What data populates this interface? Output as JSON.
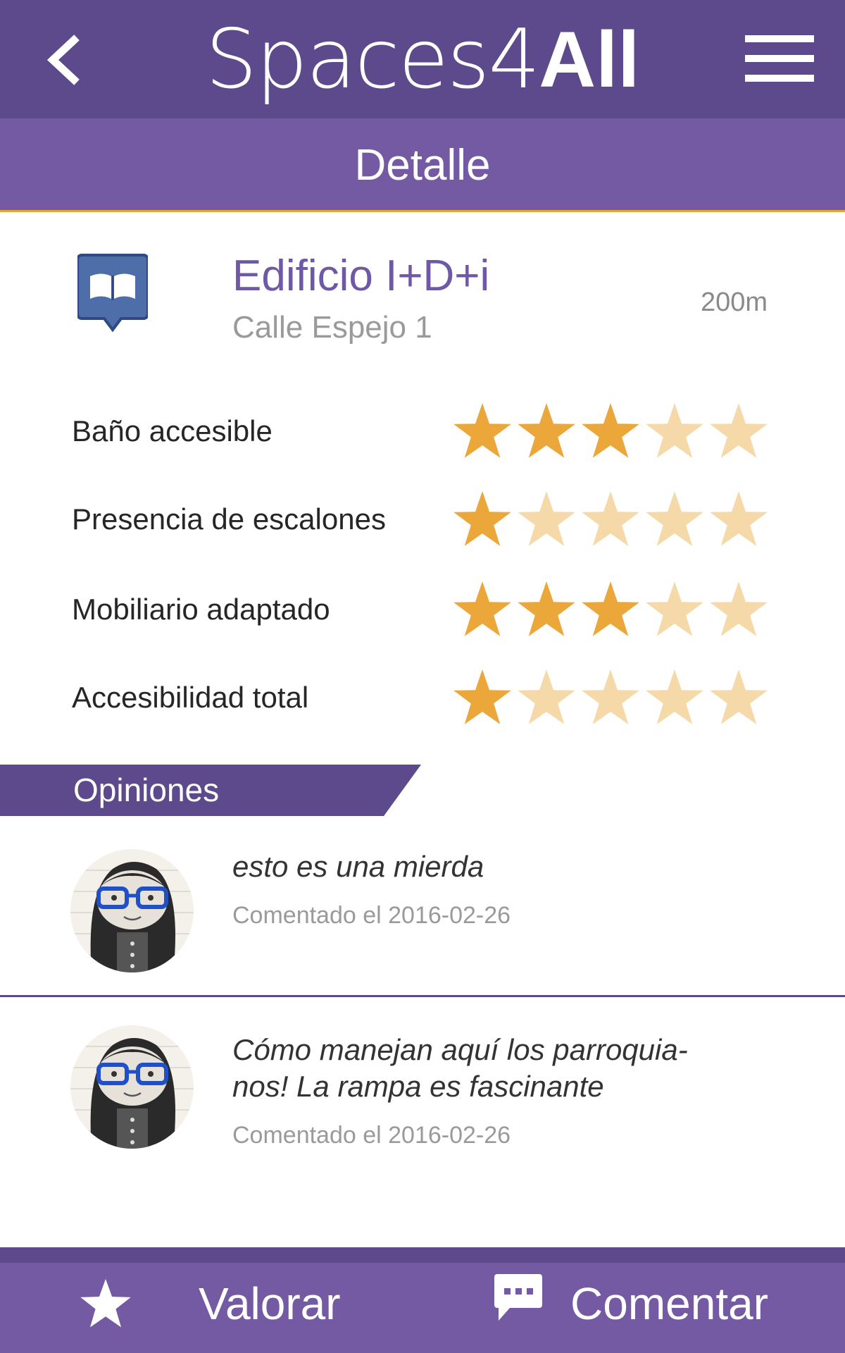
{
  "header": {
    "back_icon": "chevron-left-icon",
    "logo_light": "Spaces4",
    "logo_bold": "All",
    "menu_icon": "hamburger-menu-icon"
  },
  "subheader": {
    "title": "Detalle"
  },
  "place": {
    "icon": "library-book-pin-icon",
    "name": "Edificio I+D+i",
    "address": "Calle Espejo 1",
    "distance": "200m"
  },
  "ratings": [
    {
      "label": "Baño accesible",
      "stars": 3,
      "max": 5
    },
    {
      "label": "Presencia de escalones",
      "stars": 1,
      "max": 5
    },
    {
      "label": "Mobiliario adaptado",
      "stars": 3,
      "max": 5
    },
    {
      "label": "Accesibilidad total",
      "stars": 1,
      "max": 5
    }
  ],
  "opinions": {
    "title": "Opiniones",
    "comments": [
      {
        "avatar": "user-avatar-girl-glasses",
        "text": "esto es una mierda",
        "date": "Comentado el 2016-02-26"
      },
      {
        "avatar": "user-avatar-girl-glasses",
        "text_line1": "Cómo manejan aquí los parroquia-",
        "text_line2": "nos! La rampa es fascinante",
        "date": "Comentado el 2016-02-26"
      }
    ]
  },
  "actions": {
    "rate_label": "Valorar",
    "rate_icon": "star-icon",
    "comment_label": "Comentar",
    "comment_icon": "chat-bubble-icon"
  },
  "colors": {
    "header_dark": "#5d4a8c",
    "header_light": "#7459a3",
    "star_filled": "#eba73a",
    "star_empty": "#f5d9a8",
    "accent_line": "#e9a23b"
  }
}
